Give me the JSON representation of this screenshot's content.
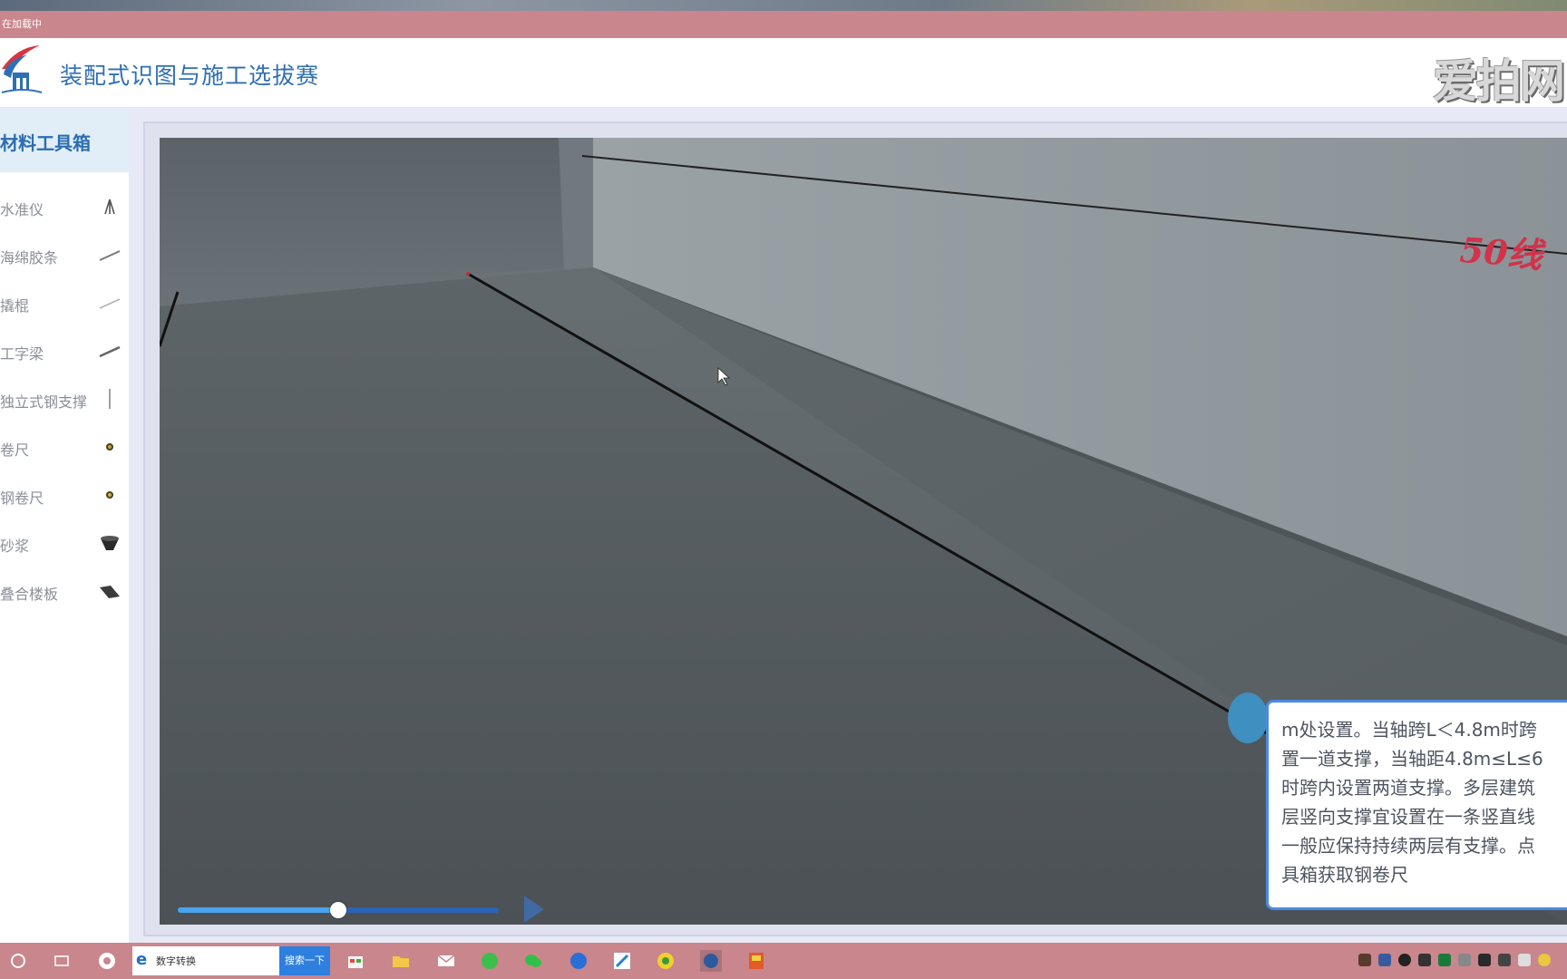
{
  "window": {
    "title_text": "在加载中"
  },
  "header": {
    "app_title": "装配式识图与施工选拔赛",
    "watermark": "爱拍网"
  },
  "sidebar": {
    "title": "材料工具箱",
    "items": [
      {
        "label": "水准仪",
        "icon": "tripod-icon"
      },
      {
        "label": "海绵胶条",
        "icon": "strip-icon"
      },
      {
        "label": "撬棍",
        "icon": "crowbar-icon"
      },
      {
        "label": "工字梁",
        "icon": "beam-icon"
      },
      {
        "label": "独立式钢支撑",
        "icon": "steel-prop-icon"
      },
      {
        "label": "卷尺",
        "icon": "tape-measure-icon"
      },
      {
        "label": "钢卷尺",
        "icon": "steel-tape-icon"
      },
      {
        "label": "砂浆",
        "icon": "mortar-icon"
      },
      {
        "label": "叠合楼板",
        "icon": "slab-icon"
      }
    ]
  },
  "scene": {
    "wall_marker": "50线",
    "progress": 0.5
  },
  "tip": {
    "lines": [
      "m处设置。当轴跨L＜4.8m时跨",
      "置一道支撑，当轴距4.8m≤L≤6",
      "时跨内设置两道支撑。多层建筑",
      "层竖向支撑宜设置在一条竖直线",
      "一般应保持持续两层有支撑。点",
      "具箱获取钢卷尺"
    ]
  },
  "taskbar": {
    "search_text": "数字转换",
    "search_button": "搜索一下"
  },
  "colors": {
    "accent": "#2c6db0",
    "title_bar": "#c9868c",
    "marker": "#d2324a"
  }
}
